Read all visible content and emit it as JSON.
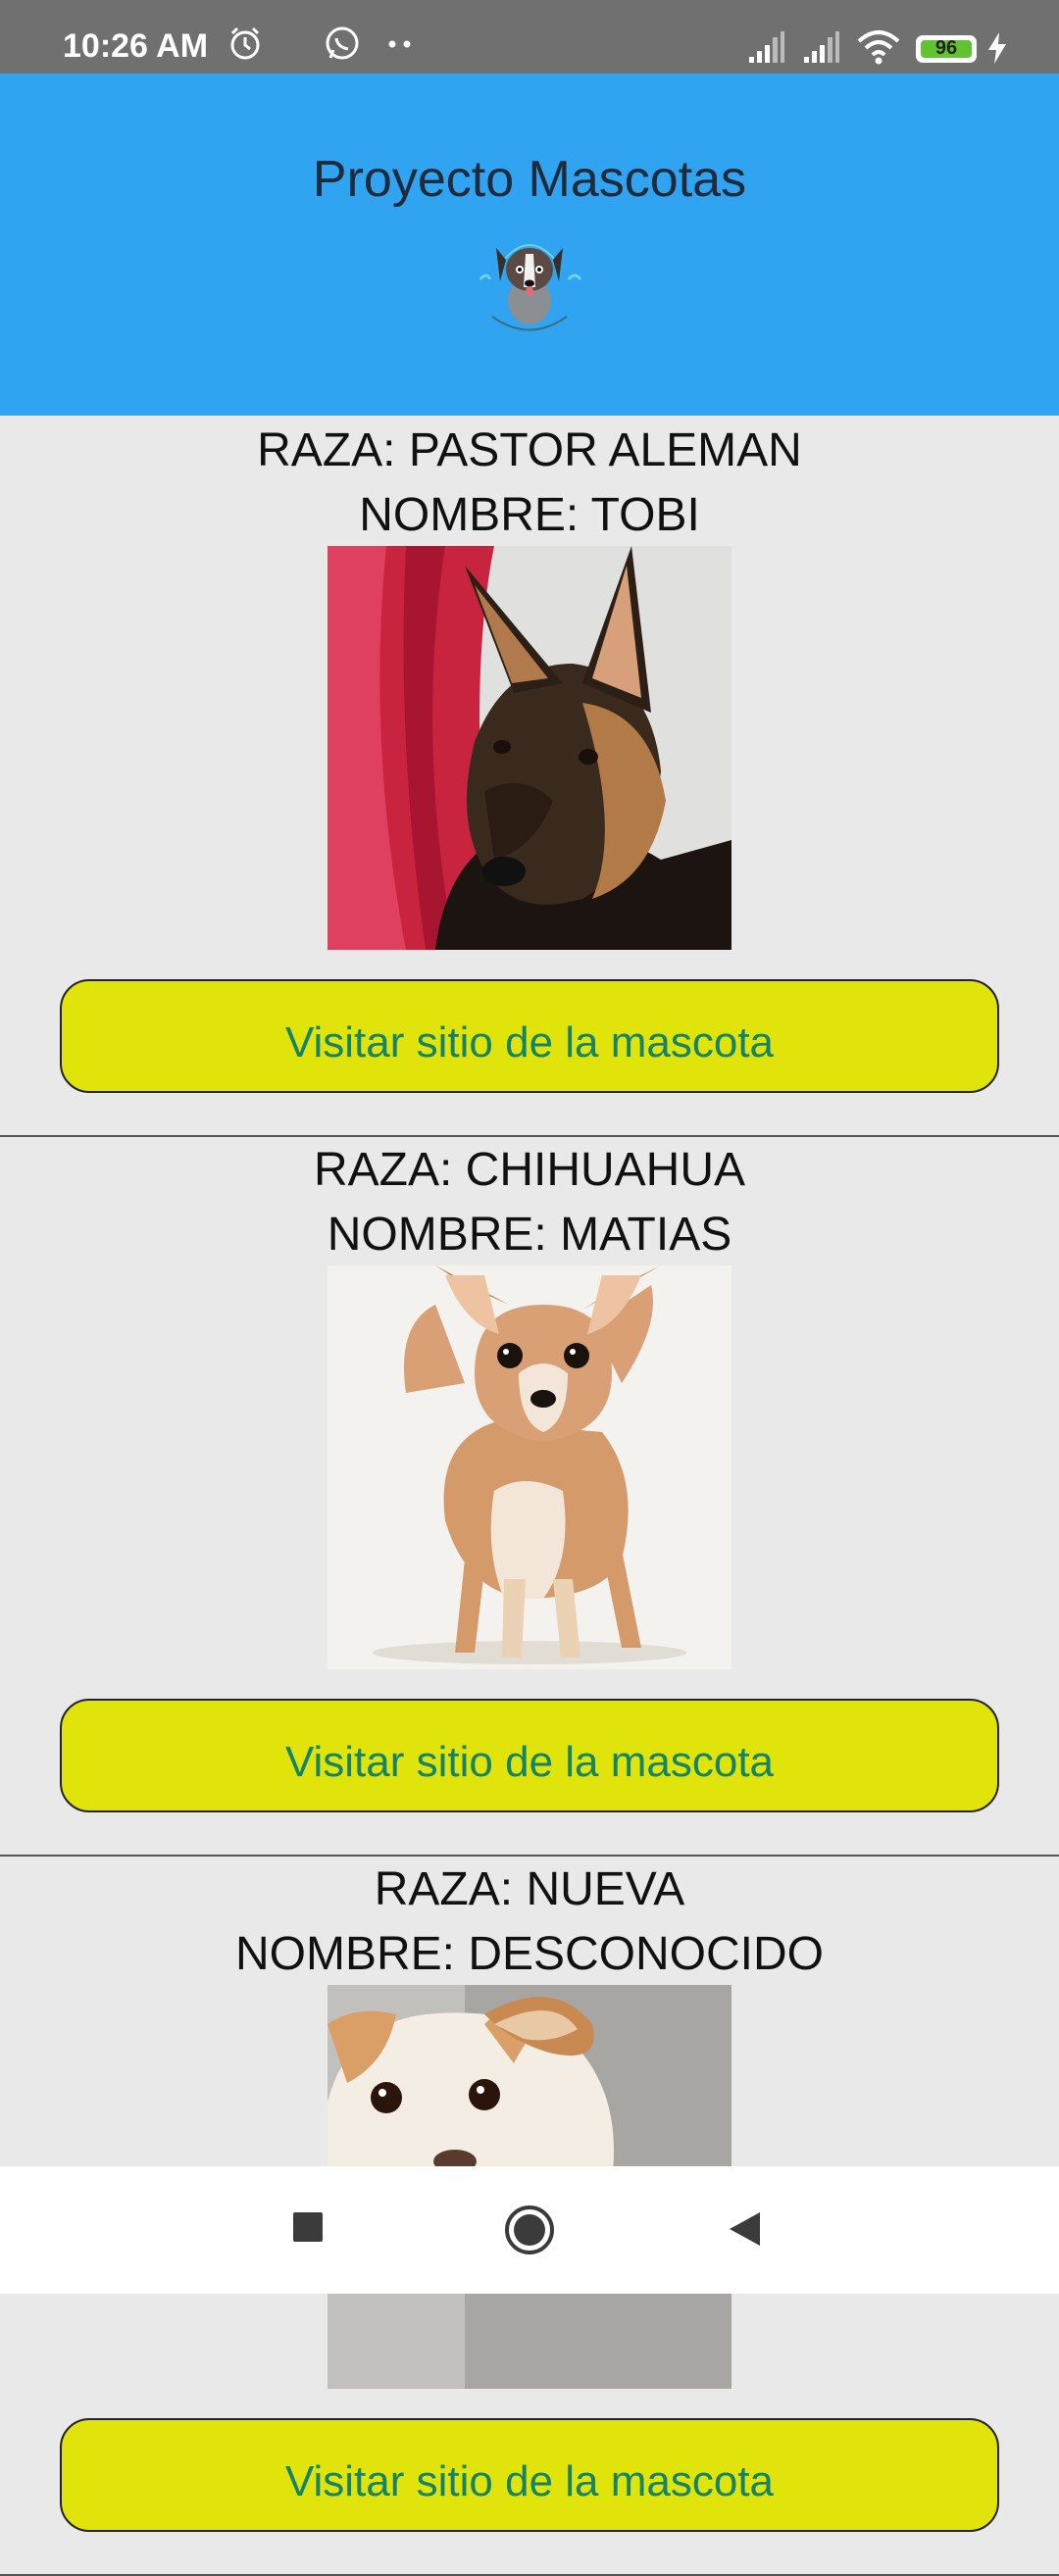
{
  "status_bar": {
    "time": "10:26 AM",
    "battery_percent": "96",
    "icons": [
      "alarm-icon",
      "whatsapp-icon",
      "more-dots-icon",
      "signal-icon",
      "signal-icon",
      "wifi-icon",
      "battery-icon",
      "charging-icon"
    ]
  },
  "header": {
    "title": "Proyecto Mascotas",
    "logo_icon": "dog-care-logo"
  },
  "pets": [
    {
      "breed": "RAZA: PASTOR ALEMAN",
      "name": "NOMBRE: TOBI",
      "button": "Visitar sitio de la mascota"
    },
    {
      "breed": "RAZA: CHIHUAHUA",
      "name": "NOMBRE: MATIAS",
      "button": "Visitar sitio de la mascota"
    },
    {
      "breed": "RAZA: NUEVA",
      "name": "NOMBRE: DESCONOCIDO",
      "button": "Visitar sitio de la mascota"
    }
  ],
  "nav_bar": {
    "icons": [
      "recents-square-icon",
      "home-circle-icon",
      "back-triangle-icon"
    ]
  },
  "colors": {
    "header_bg": "#30a3f1",
    "status_bar_bg": "#707070",
    "button_bg": "#e0e40a",
    "button_text": "#13846a",
    "page_bg": "#e9e9e9"
  }
}
